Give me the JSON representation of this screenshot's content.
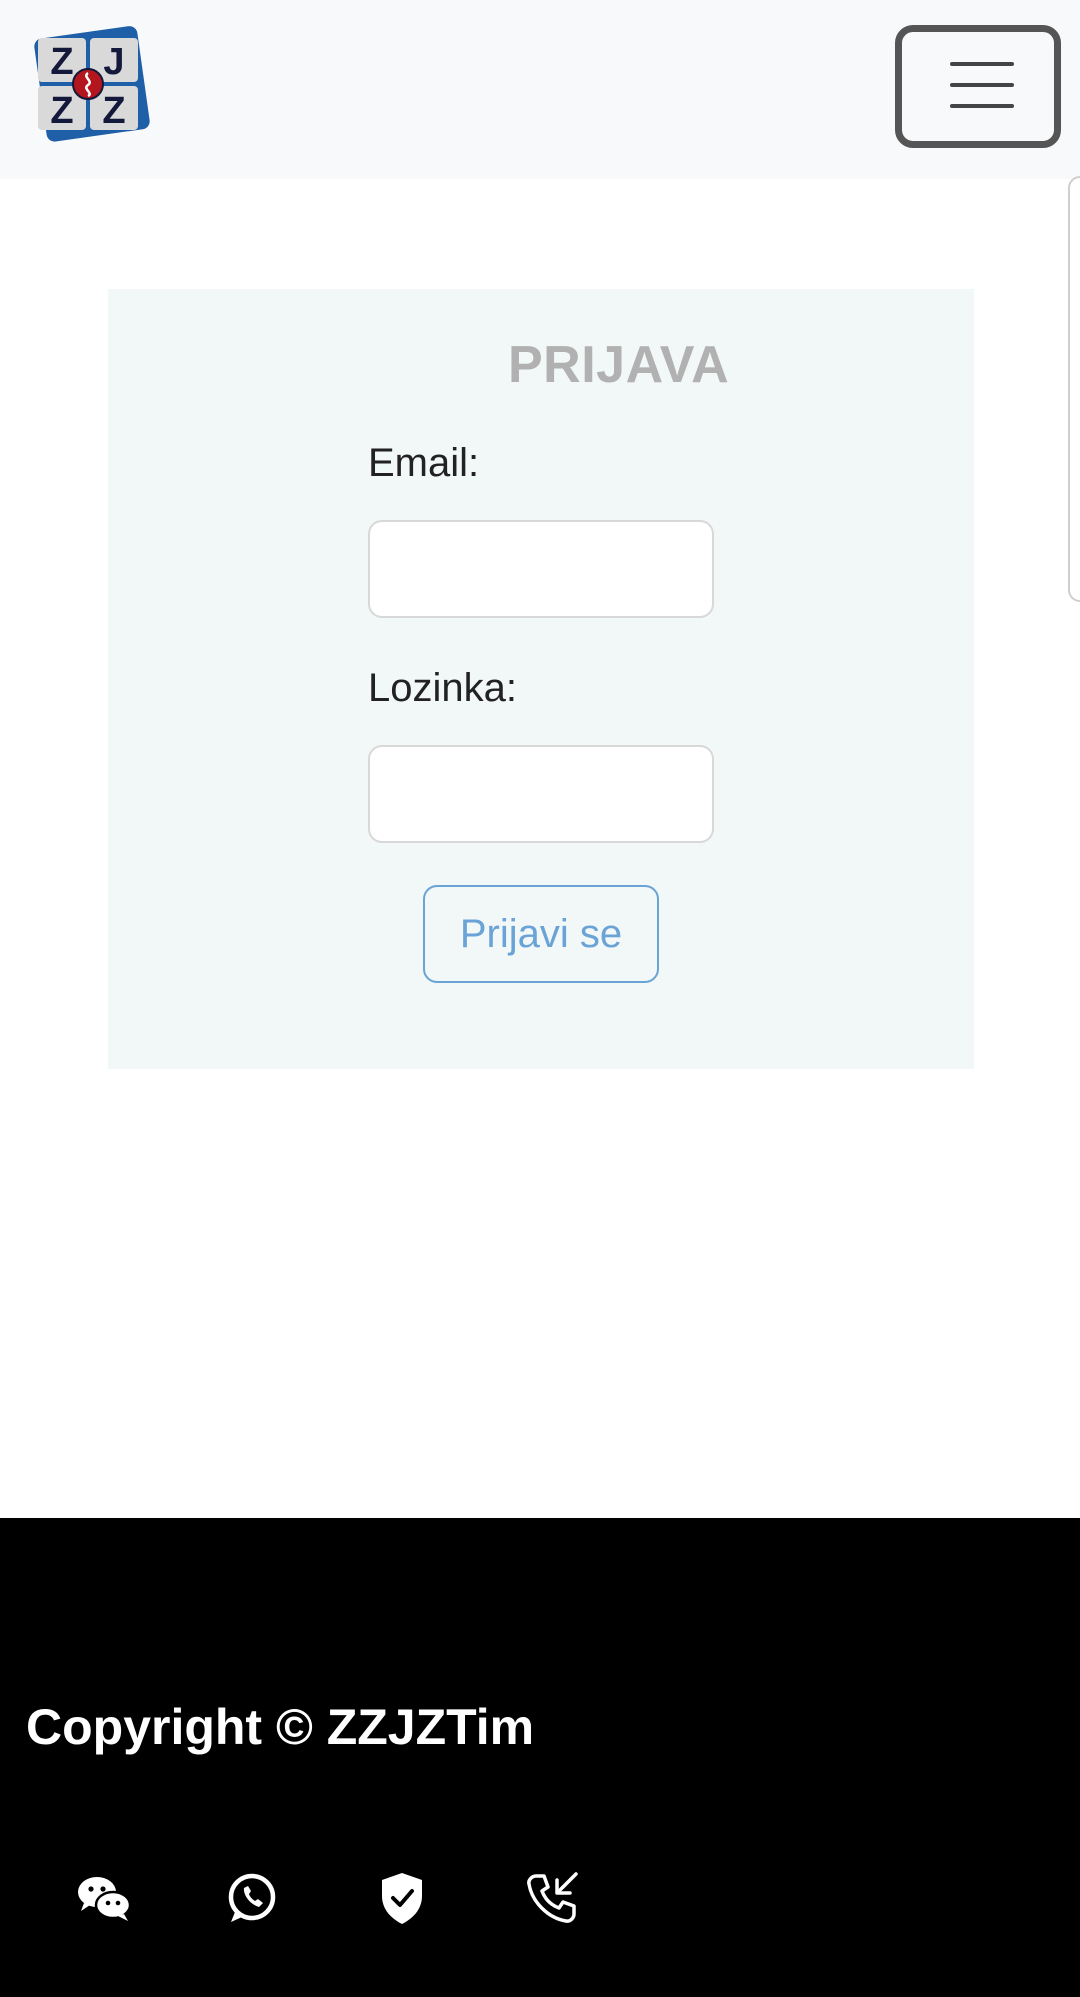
{
  "header": {
    "logo_text": "ZJZZ",
    "menu_icon": "hamburger-icon"
  },
  "login": {
    "title": "PRIJAVA",
    "email_label": "Email:",
    "email_value": "",
    "password_label": "Lozinka:",
    "password_value": "",
    "submit_label": "Prijavi se"
  },
  "footer": {
    "copyright": "Copyright © ZZJZTim",
    "social_icons": [
      "wechat-icon",
      "whatsapp-icon",
      "shield-check-icon",
      "phone-incoming-icon"
    ]
  },
  "colors": {
    "navbar_bg": "#f8f9fa",
    "card_bg": "#f2f7f7",
    "title": "#b1b1b1",
    "button_accent": "#6aa3d6",
    "footer_bg": "#000000"
  }
}
